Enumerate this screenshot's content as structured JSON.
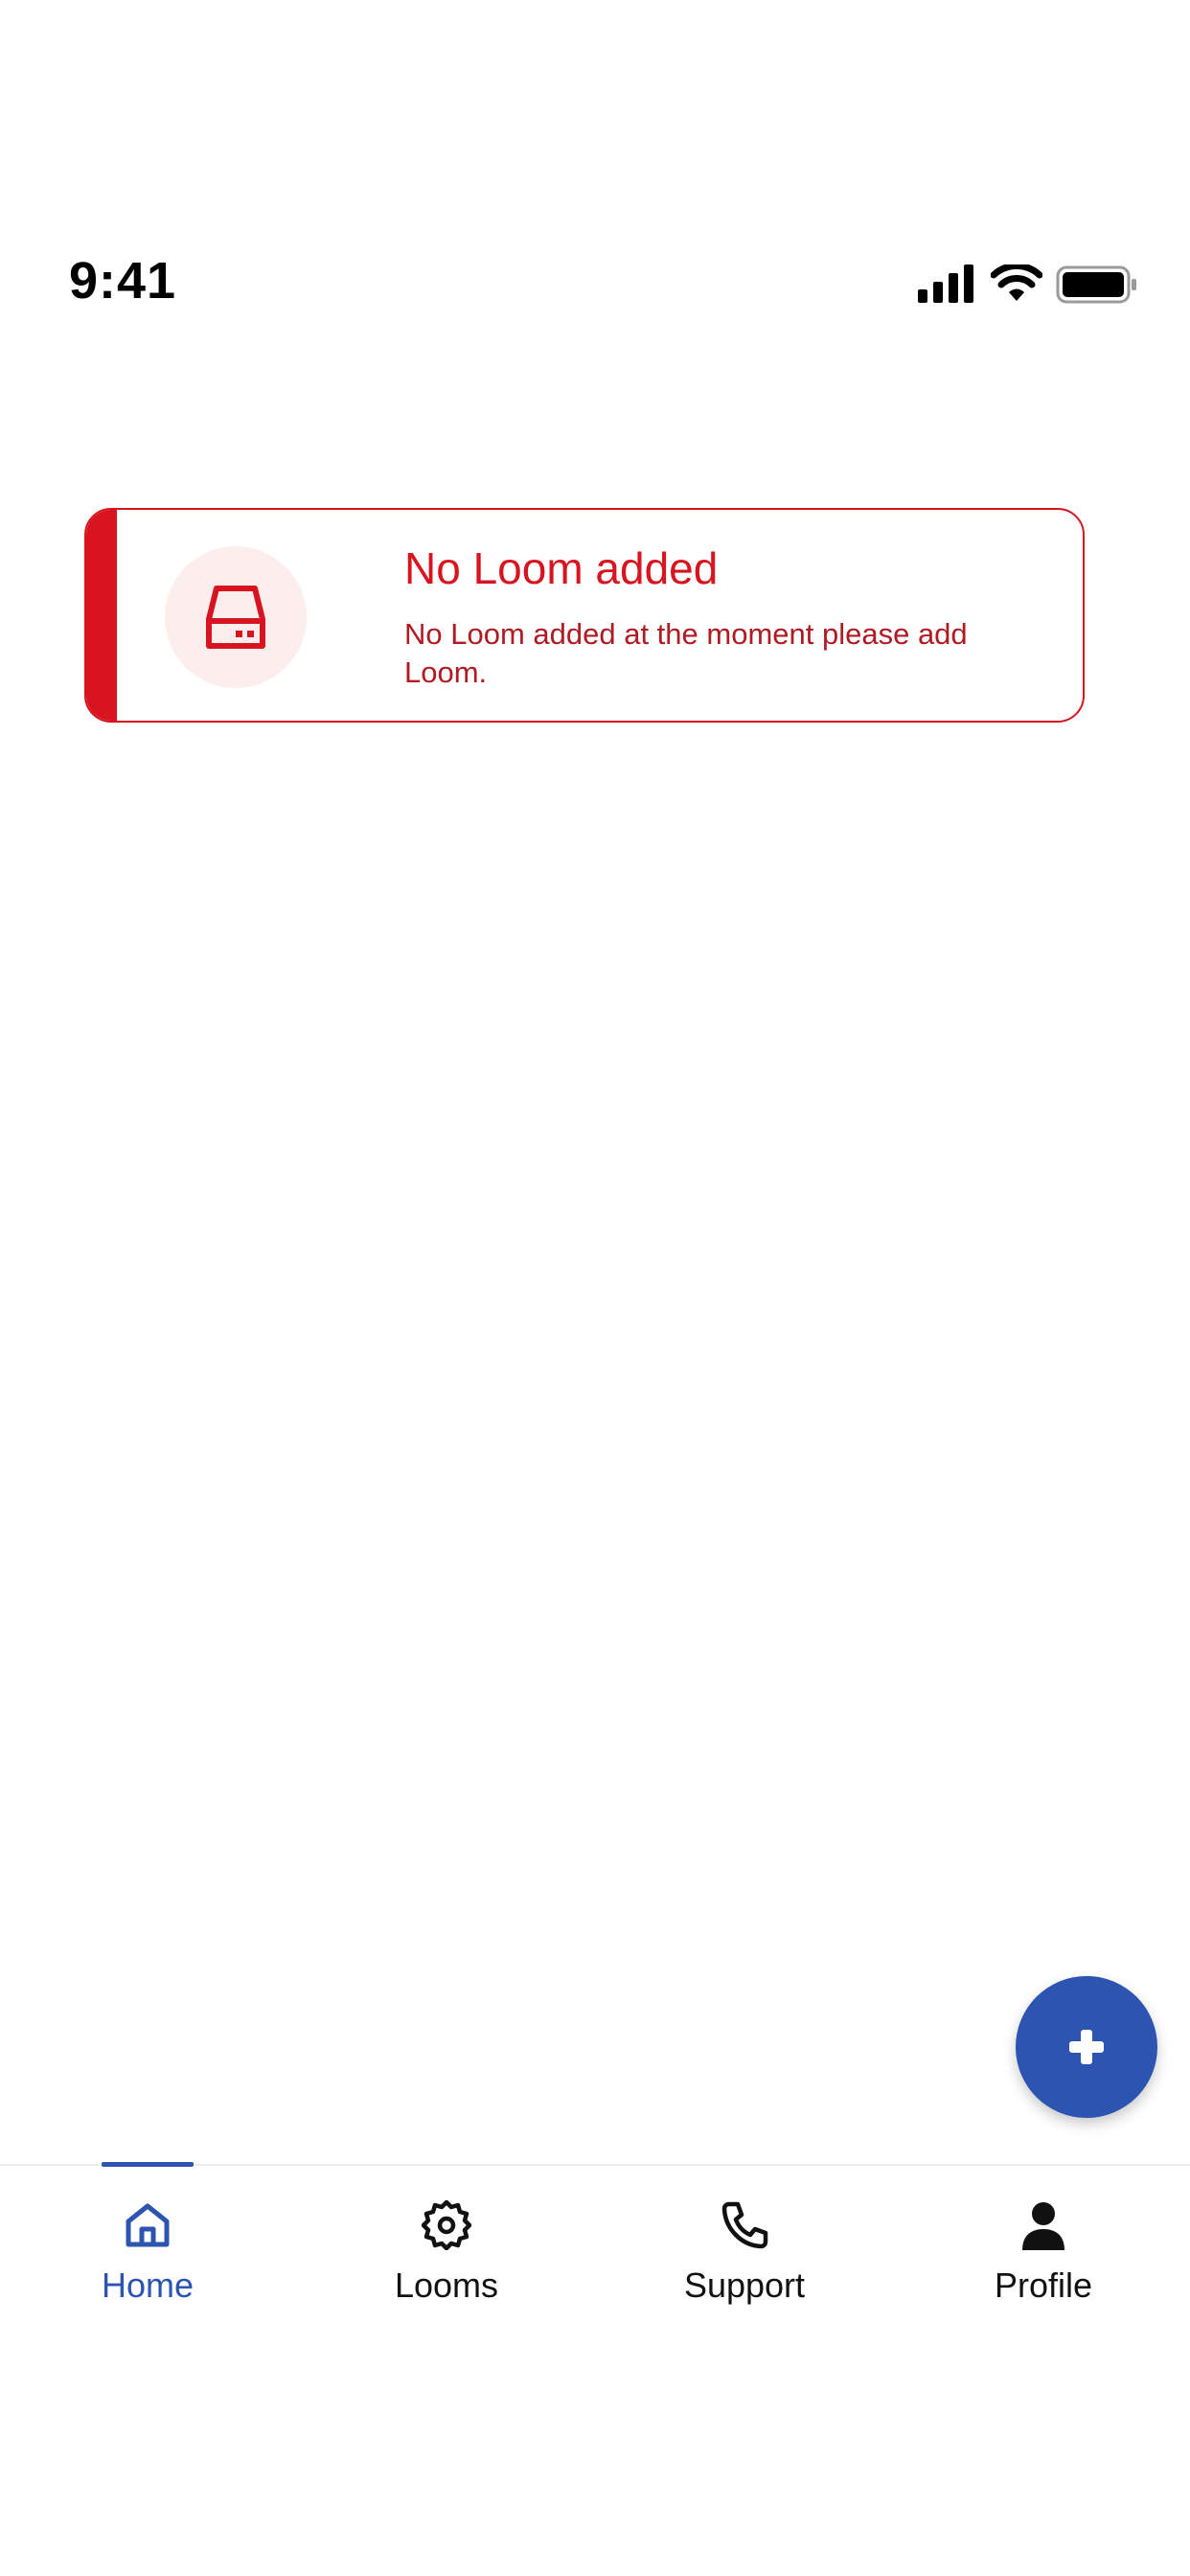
{
  "status_bar": {
    "time": "9:41",
    "icons": [
      "signal-icon",
      "wifi-icon",
      "battery-icon"
    ]
  },
  "alert": {
    "icon": "hard-drive-icon",
    "title": "No Loom added",
    "message": "No Loom added at the moment please add Loom.",
    "colors": {
      "accent": "#d7141f",
      "icon_background": "#fdeeee"
    }
  },
  "fab": {
    "icon": "plus-icon",
    "color": "#2c54b0"
  },
  "bottom_nav": {
    "active_color": "#2c54b0",
    "items": [
      {
        "label": "Home",
        "icon": "home-icon",
        "active": true
      },
      {
        "label": "Looms",
        "icon": "gear-icon",
        "active": false
      },
      {
        "label": "Support",
        "icon": "phone-icon",
        "active": false
      },
      {
        "label": "Profile",
        "icon": "user-icon",
        "active": false
      }
    ]
  }
}
